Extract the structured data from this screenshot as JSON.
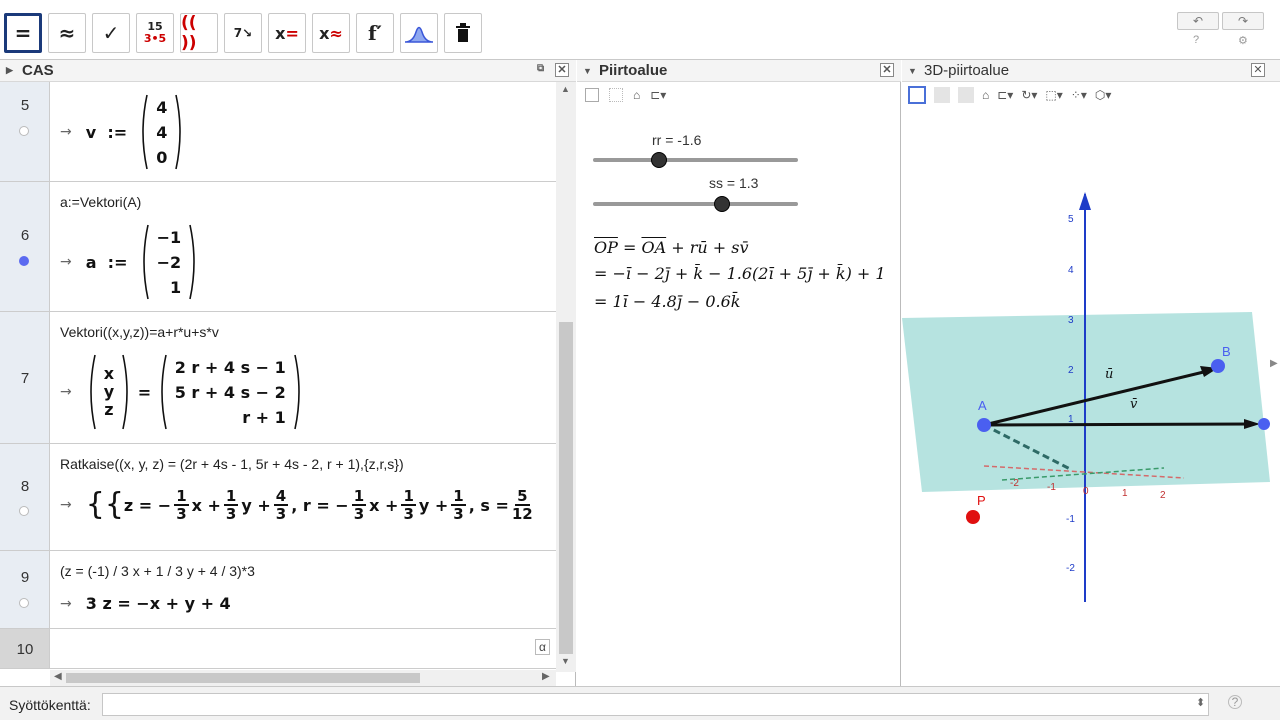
{
  "toolbar": {
    "tools": [
      {
        "name": "evaluate",
        "label": "="
      },
      {
        "name": "numeric",
        "label": "≈"
      },
      {
        "name": "keep-input",
        "label": "✓"
      },
      {
        "name": "factor",
        "label": "15\n3·5"
      },
      {
        "name": "expand",
        "label": "(( ))"
      },
      {
        "name": "substitute",
        "label": "7↘"
      },
      {
        "name": "solve",
        "label": "x="
      },
      {
        "name": "solve-numerically",
        "label": "x≈"
      },
      {
        "name": "derivative",
        "label": "f′"
      },
      {
        "name": "probability",
        "label": "⌓"
      },
      {
        "name": "delete",
        "label": "🗑"
      }
    ],
    "undo": "↶",
    "redo": "↷"
  },
  "cas": {
    "title": "CAS",
    "rows": [
      {
        "num": "5",
        "input": "",
        "output_name": "v"
      },
      {
        "num": "6",
        "input": "a:=Vektori(A)",
        "output_name": "a"
      },
      {
        "num": "7",
        "input": "Vektori((x,y,z))=a+r*u+s*v"
      },
      {
        "num": "8",
        "input": "Ratkaise((x, y, z) = (2r + 4s - 1, 5r + 4s - 2, r + 1),{z,r,s})"
      },
      {
        "num": "9",
        "input": "(z = (-1) / 3 x + 1 / 3 y + 4 / 3)*3",
        "output": "3 z = −x + y + 4"
      },
      {
        "num": "10",
        "input": ""
      }
    ],
    "vector_v": [
      "4",
      "4",
      "0"
    ],
    "vector_a": [
      "−1",
      "−2",
      "1"
    ],
    "xyz": [
      "x",
      "y",
      "z"
    ],
    "rhs": [
      "2 r + 4 s − 1",
      "5 r + 4 s − 2",
      "r + 1"
    ],
    "alpha": "α"
  },
  "graphics": {
    "title": "Piirtoalue",
    "slider_rr": {
      "label": "rr = -1.6",
      "value": 0.32
    },
    "slider_ss": {
      "label": "ss = 1.3",
      "value": 0.63
    },
    "eq1": "OP = OA + rū + sv̄",
    "eq2": "= −ī − 2j̄ + k̄ − 1.6(2ī + 5j̄ + k̄) + 1",
    "eq3": "= 1ī − 4.8j̄ − 0.6k̄"
  },
  "view3d": {
    "title": "3D-piirtoalue",
    "labels": {
      "A": "A",
      "B": "B",
      "P": "P",
      "u": "ū",
      "v": "v̄"
    },
    "axis_ticks": [
      "5",
      "4",
      "3",
      "2",
      "1",
      "-1",
      "-2"
    ],
    "floor_ticks": [
      "-2",
      "-1",
      "0",
      "1",
      "2"
    ]
  },
  "input_bar": {
    "label": "Syöttökenttä:"
  }
}
